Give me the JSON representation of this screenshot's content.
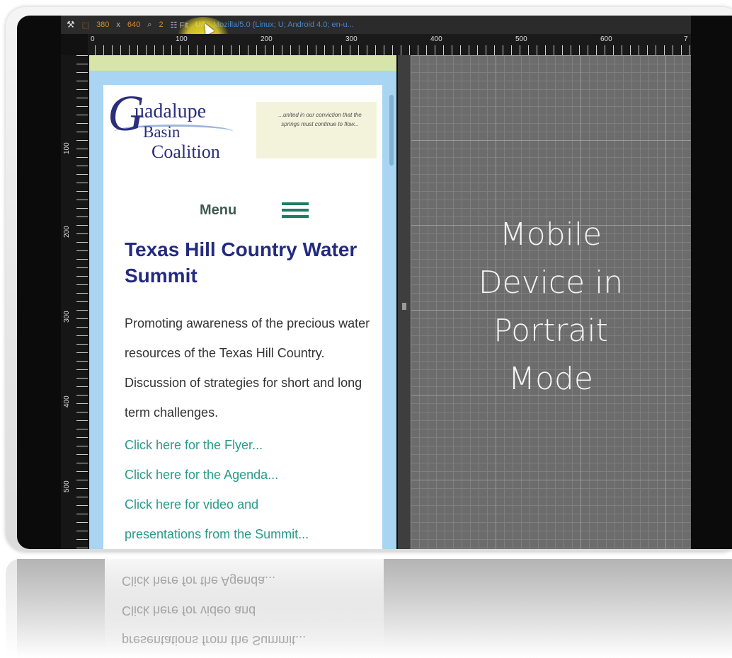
{
  "toolbar": {
    "width": "380",
    "x": "x",
    "height": "640",
    "zoom": "2",
    "fit": "Fit",
    "ua_label": "UA",
    "ua_value": "Mozilla/5.0 (Linux; U; Android 4.0; en-u..."
  },
  "ruler": {
    "h_ticks": [
      "0",
      "100",
      "200",
      "300",
      "400",
      "500",
      "600",
      "7"
    ],
    "v_ticks": [
      "100",
      "200",
      "300",
      "400",
      "500"
    ]
  },
  "site": {
    "logo": {
      "initial": "G",
      "line1": "uadalupe",
      "line2": "Basin",
      "line3": "Coalition"
    },
    "tagline": "...united in our conviction that the springs must continue to flow...",
    "menu_label": "Menu",
    "title": "Texas Hill Country Water Summit",
    "description": "Promoting awareness of the precious water resources of the Texas Hill Country. Discussion of strategies for short and long term challenges.",
    "links": [
      "Click here for the Flyer...",
      "Click here for the Agenda...",
      "Click here for video and",
      "presentations from the Summit..."
    ]
  },
  "caption": {
    "line1": "Mobile",
    "line2": "Device in",
    "line3": "Portrait",
    "line4": "Mode"
  },
  "colors": {
    "site_title": "#242a80",
    "link": "#2a9a8a",
    "hamburger": "#1e7d68",
    "viewport_frame": "#a9d4f2",
    "grid_background": "#6c6c6c"
  }
}
